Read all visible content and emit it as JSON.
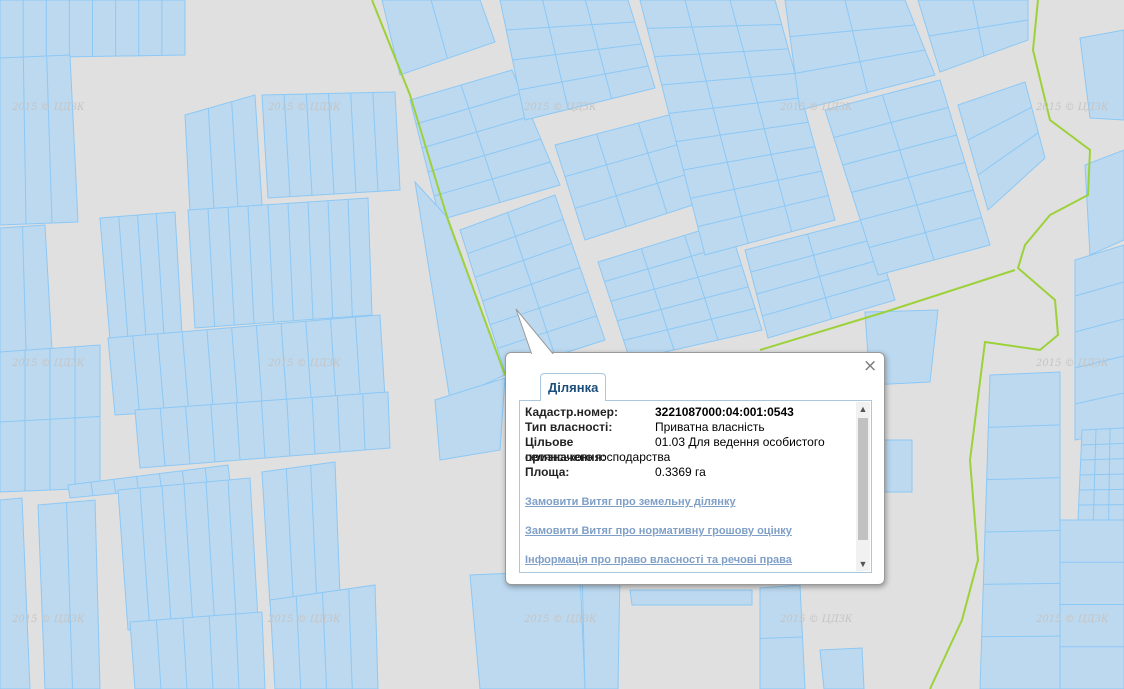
{
  "map": {
    "colors": {
      "background": "#e0e0e0",
      "parcel_fill": "#bcd9f0",
      "parcel_stroke": "#8cc8f5",
      "boundary_line": "#9dd13a"
    },
    "watermark_text": "2015 © ЦДЗК"
  },
  "popup": {
    "tab_label": "Ділянка",
    "close_icon": "×",
    "rows": [
      {
        "label": "Кадастр.номер:",
        "value": "3221087000:04:001:0543",
        "bold": true
      },
      {
        "label": "Тип власності:",
        "value": "Приватна власність"
      },
      {
        "label": "Цільове призначення:",
        "value": "01.03 Для ведення особистого",
        "value_cont": "селянського господарства"
      },
      {
        "label": "Площа:",
        "value": "0.3369 га"
      }
    ],
    "links": [
      "Замовити Витяг про земельну ділянку",
      "Замовити Витяг про нормативну грошову оцінку",
      "Інформація про право власності та речові права"
    ],
    "scroll_up_icon": "▲",
    "scroll_down_icon": "▼"
  }
}
